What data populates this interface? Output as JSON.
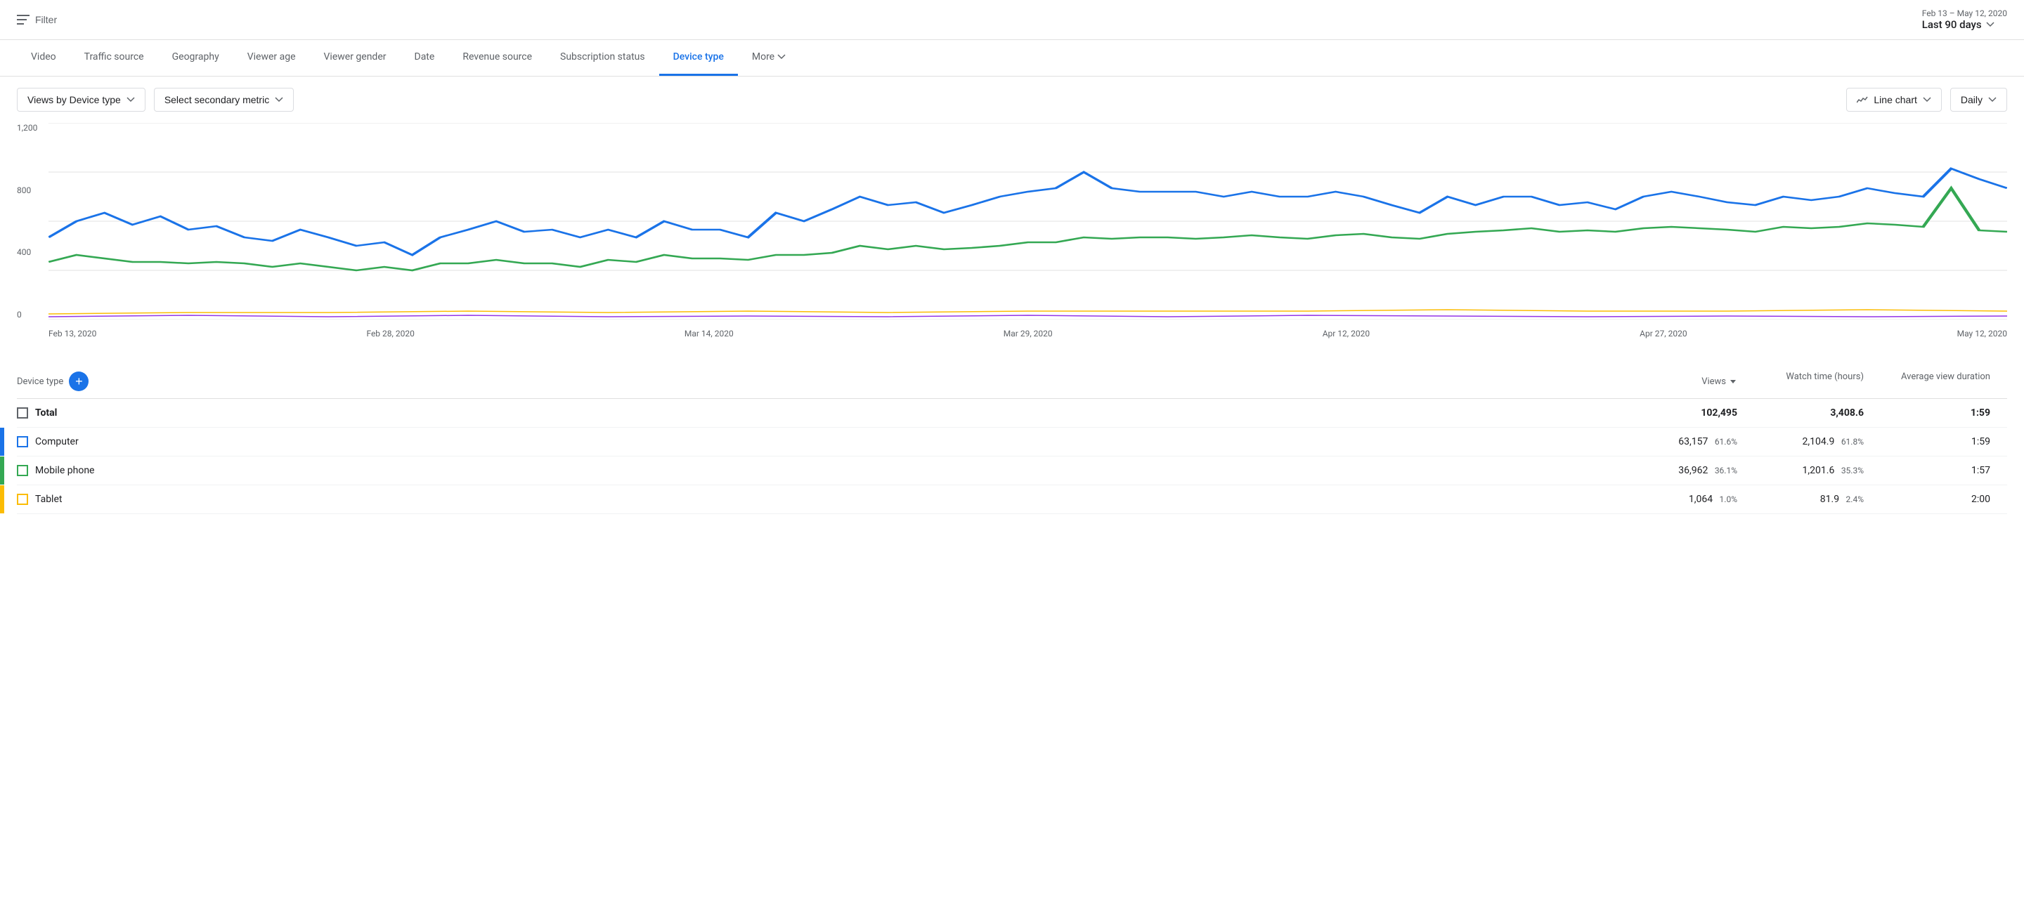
{
  "topbar": {
    "filter_label": "Filter",
    "date_range": "Feb 13 – May 12, 2020",
    "date_preset": "Last 90 days"
  },
  "nav": {
    "tabs": [
      {
        "id": "video",
        "label": "Video",
        "active": false
      },
      {
        "id": "traffic-source",
        "label": "Traffic source",
        "active": false
      },
      {
        "id": "geography",
        "label": "Geography",
        "active": false
      },
      {
        "id": "viewer-age",
        "label": "Viewer age",
        "active": false
      },
      {
        "id": "viewer-gender",
        "label": "Viewer gender",
        "active": false
      },
      {
        "id": "date",
        "label": "Date",
        "active": false
      },
      {
        "id": "revenue-source",
        "label": "Revenue source",
        "active": false
      },
      {
        "id": "subscription-status",
        "label": "Subscription status",
        "active": false
      },
      {
        "id": "device-type",
        "label": "Device type",
        "active": true
      },
      {
        "id": "more",
        "label": "More",
        "active": false
      }
    ]
  },
  "controls": {
    "primary_metric": "Views by Device type",
    "secondary_metric": "Select secondary metric",
    "chart_type": "Line chart",
    "time_period": "Daily"
  },
  "chart": {
    "y_labels": [
      "1,200",
      "800",
      "400",
      "0"
    ],
    "x_labels": [
      "Feb 13, 2020",
      "Feb 28, 2020",
      "Mar 14, 2020",
      "Mar 29, 2020",
      "Apr 12, 2020",
      "Apr 27, 2020",
      "May 12, 2020"
    ],
    "colors": {
      "computer": "#1a73e8",
      "mobile": "#34a853",
      "tablet": "#fbbc04",
      "tv": "#9334e6"
    }
  },
  "table": {
    "headers": {
      "device": "Device type",
      "views": "Views",
      "watch_time": "Watch time (hours)",
      "avg_duration": "Average view duration"
    },
    "total": {
      "views": "102,495",
      "watch_time": "3,408.6",
      "avg_duration": "1:59"
    },
    "rows": [
      {
        "id": "computer",
        "name": "Computer",
        "color": "#1a73e8",
        "views": "63,157",
        "views_pct": "61.6%",
        "watch_time": "2,104.9",
        "watch_time_pct": "61.8%",
        "avg_duration": "1:59"
      },
      {
        "id": "mobile",
        "name": "Mobile phone",
        "color": "#34a853",
        "views": "36,962",
        "views_pct": "36.1%",
        "watch_time": "1,201.6",
        "watch_time_pct": "35.3%",
        "avg_duration": "1:57"
      },
      {
        "id": "tablet",
        "name": "Tablet",
        "color": "#fbbc04",
        "views": "1,064",
        "views_pct": "1.0%",
        "watch_time": "81.9",
        "watch_time_pct": "2.4%",
        "avg_duration": "2:00"
      }
    ]
  }
}
